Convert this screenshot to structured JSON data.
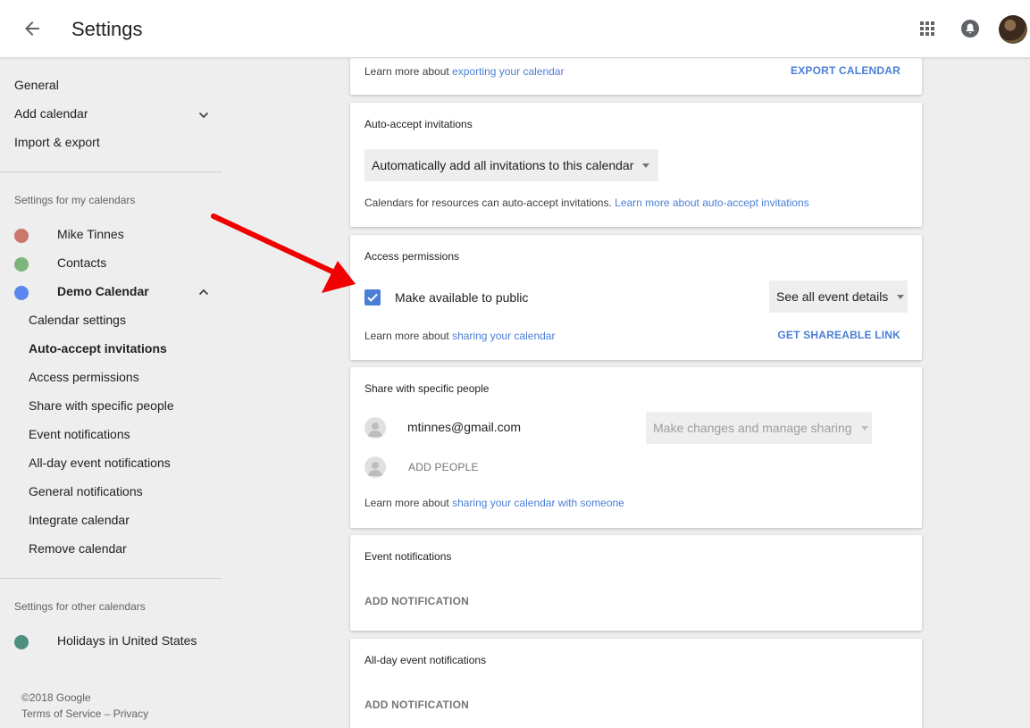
{
  "header": {
    "title": "Settings"
  },
  "sidebar": {
    "top_items": [
      {
        "label": "General"
      },
      {
        "label": "Add calendar"
      },
      {
        "label": "Import & export"
      }
    ],
    "my_calendars_label": "Settings for my calendars",
    "my_calendars": [
      {
        "name": "Mike Tinnes",
        "color": "#c9786b"
      },
      {
        "name": "Contacts",
        "color": "#7bb57b"
      },
      {
        "name": "Demo Calendar",
        "color": "#5c86ef"
      }
    ],
    "demo_subitems": [
      {
        "label": "Calendar settings"
      },
      {
        "label": "Auto-accept invitations"
      },
      {
        "label": "Access permissions"
      },
      {
        "label": "Share with specific people"
      },
      {
        "label": "Event notifications"
      },
      {
        "label": "All-day event notifications"
      },
      {
        "label": "General notifications"
      },
      {
        "label": "Integrate calendar"
      },
      {
        "label": "Remove calendar"
      }
    ],
    "other_calendars_label": "Settings for other calendars",
    "other_calendars": [
      {
        "name": "Holidays in United States",
        "color": "#4f8f7f"
      }
    ],
    "footer": {
      "copyright": "©2018 Google",
      "terms": "Terms of Service",
      "separator": "–",
      "privacy": "Privacy"
    }
  },
  "export_card": {
    "learn_prefix": "Learn more about ",
    "learn_link": "exporting your calendar",
    "action": "EXPORT CALENDAR"
  },
  "auto_accept_card": {
    "title": "Auto-accept invitations",
    "dropdown_value": "Automatically add all invitations to this calendar",
    "help_prefix": "Calendars for resources can auto-accept invitations. ",
    "help_link": "Learn more about auto-accept invitations"
  },
  "access_card": {
    "title": "Access permissions",
    "checkbox_label": "Make available to public",
    "checkbox_checked": true,
    "dropdown_value": "See all event details",
    "learn_prefix": "Learn more about ",
    "learn_link": "sharing your calendar",
    "action": "GET SHAREABLE LINK"
  },
  "share_card": {
    "title": "Share with specific people",
    "person_email": "mtinnes@gmail.com",
    "person_permission": "Make changes and manage sharing",
    "add_people": "ADD PEOPLE",
    "learn_prefix": "Learn more about ",
    "learn_link": "sharing your calendar with someone"
  },
  "event_notif_card": {
    "title": "Event notifications",
    "action": "ADD NOTIFICATION"
  },
  "allday_notif_card": {
    "title": "All-day event notifications",
    "action": "ADD NOTIFICATION"
  },
  "colors": {
    "accent": "#4a7fd6",
    "annotation_arrow": "#f00000"
  }
}
